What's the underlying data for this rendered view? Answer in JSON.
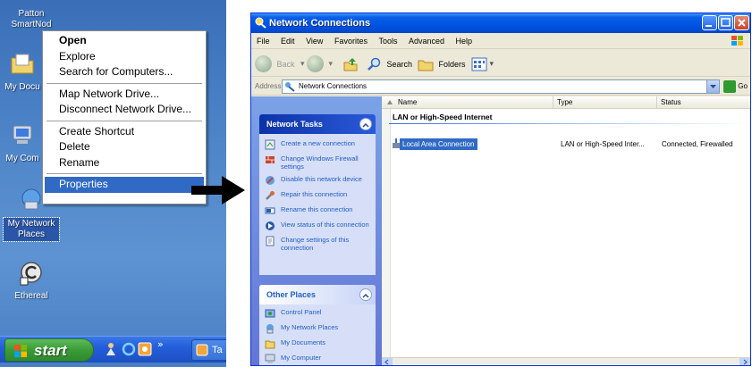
{
  "desktop": {
    "icons": [
      {
        "label": "Patton SmartNod"
      },
      {
        "label": "My Docu"
      },
      {
        "label": "My Com"
      },
      {
        "label": "My Network Places"
      },
      {
        "label": "Ethereal"
      }
    ]
  },
  "context_menu": {
    "items": [
      "Open",
      "Explore",
      "Search for Computers...",
      "Map Network Drive...",
      "Disconnect Network Drive...",
      "Create Shortcut",
      "Delete",
      "Rename",
      "Properties"
    ],
    "selected": "Properties"
  },
  "taskbar": {
    "start_label": "start",
    "task_label": "Ta",
    "overflow": "»"
  },
  "window": {
    "title": "Network Connections",
    "menu": [
      "File",
      "Edit",
      "View",
      "Favorites",
      "Tools",
      "Advanced",
      "Help"
    ],
    "toolbar": {
      "back": "Back",
      "search": "Search",
      "folders": "Folders"
    },
    "address": {
      "label": "Address",
      "value": "Network Connections",
      "go": "Go"
    },
    "network_tasks": {
      "title": "Network Tasks",
      "links": [
        "Create a new connection",
        "Change Windows Firewall settings",
        "Disable this network device",
        "Repair this connection",
        "Rename this connection",
        "View status of this connection",
        "Change settings of this connection"
      ]
    },
    "other_places": {
      "title": "Other Places",
      "links": [
        "Control Panel",
        "My Network Places",
        "My Documents",
        "My Computer"
      ]
    },
    "columns": {
      "name": "Name",
      "type": "Type",
      "status": "Status"
    },
    "group": "LAN or High-Speed Internet",
    "rows": [
      {
        "name": "Local Area Connection",
        "type": "LAN or High-Speed Inter...",
        "status": "Connected, Firewalled"
      }
    ]
  },
  "colors": {
    "selection": "#316ac5",
    "titlebar": "#0054e3",
    "link": "#215dc6",
    "taskbar": "#245edb",
    "start": "#3a9b37"
  }
}
